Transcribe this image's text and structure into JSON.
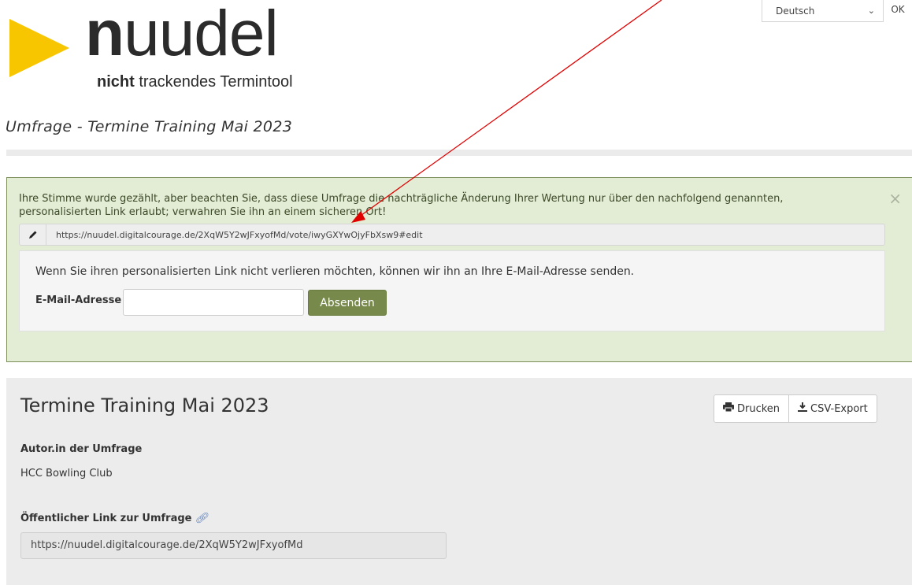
{
  "header": {
    "brand_bold": "n",
    "brand_rest": "uudel",
    "tagline_bold": "nicht",
    "tagline_rest": " trackendes Termintool",
    "language_select": "Deutsch",
    "ok_label": "OK"
  },
  "page": {
    "subtitle": "Umfrage - Termine Training Mai 2023"
  },
  "alert": {
    "message": "Ihre Stimme wurde gezählt, aber beachten Sie, dass diese Umfrage die nachträgliche Änderung Ihrer Wertung nur über den nachfolgend genannten, personalisierten Link erlaubt; verwahren Sie ihn an einem sicheren Ort!",
    "close": "×",
    "edit_link": "https://nuudel.digitalcourage.de/2XqW5Y2wJFxyofMd/vote/iwyGXYwOjyFbXsw9#edit",
    "mail_hint": "Wenn Sie ihren personalisierten Link nicht verlieren möchten, können wir ihn an Ihre E-Mail-Adresse senden.",
    "mail_label": "E-Mail-Adresse",
    "mail_value": "",
    "send_label": "Absenden"
  },
  "poll": {
    "title": "Termine Training Mai 2023",
    "print_label": "Drucken",
    "csv_label": "CSV-Export",
    "author_heading": "Autor.in der Umfrage",
    "author": "HCC Bowling Club",
    "public_link_heading": "Öffentlicher Link zur Umfrage",
    "public_link": "https://nuudel.digitalcourage.de/2XqW5Y2wJFxyofMd"
  },
  "colors": {
    "logo_yellow": "#f7c600",
    "alert_bg": "#e3ecd4",
    "send_button": "#778a4b",
    "annotation_arrow": "#e00000"
  }
}
